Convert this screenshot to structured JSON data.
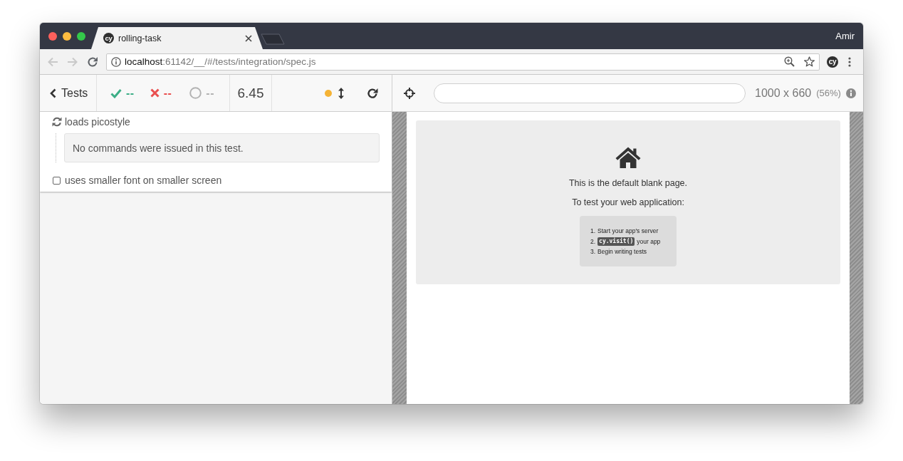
{
  "window": {
    "user": "Amir"
  },
  "browser_tab": {
    "favicon": "cy",
    "title": "rolling-task"
  },
  "toolbar": {
    "back": {
      "disabled": true
    },
    "forward": {
      "disabled": true
    },
    "url": {
      "host": "localhost",
      "path": ":61142/__/#/tests/integration/spec.js"
    },
    "extension": "cy"
  },
  "runner": {
    "back_label": "Tests",
    "stats": [
      {
        "kind": "passed",
        "count": "--"
      },
      {
        "kind": "failed",
        "count": "--"
      },
      {
        "kind": "pending",
        "count": "--"
      }
    ],
    "duration": "6.45",
    "auto_scroll": {
      "enabled": true
    }
  },
  "viewport": {
    "size": "1000 x 660",
    "scale": "(56%)"
  },
  "tests": [
    {
      "running": true,
      "title": "loads picostyle",
      "message": "No commands were issued in this test."
    },
    {
      "running": false,
      "title": "uses smaller font on smaller screen"
    }
  ],
  "blank_page": {
    "heading": "This is the default blank page.",
    "subheading": "To test your web application:",
    "steps": [
      {
        "number": "1.",
        "text": "Start your app's server"
      },
      {
        "number": "2.",
        "code": "cy.visit()",
        "text": "your app"
      },
      {
        "number": "3.",
        "text": "Begin writing tests"
      }
    ]
  }
}
